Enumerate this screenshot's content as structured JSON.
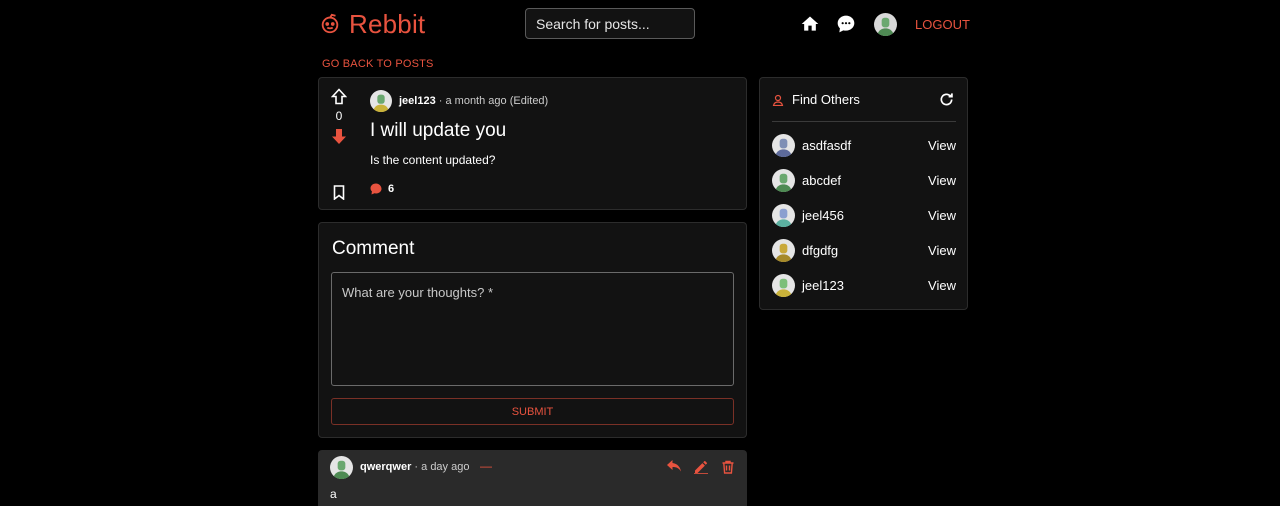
{
  "header": {
    "brand": "Rebbit",
    "search_placeholder": "Search for posts...",
    "logout_label": "LOGOUT",
    "icons": [
      "reddit-logo-icon",
      "home-icon",
      "chat-icon",
      "avatar"
    ]
  },
  "back_link": "GO BACK TO POSTS",
  "post": {
    "author": "jeel123",
    "meta": "· a month ago (Edited)",
    "title": "I will update you",
    "body": "Is the content updated?",
    "votes": "0",
    "comment_count": "6"
  },
  "comment_form": {
    "heading": "Comment",
    "placeholder": "What are your thoughts? *",
    "submit_label": "SUBMIT"
  },
  "reply": {
    "author": "qwerqwer",
    "meta": "· a day ago",
    "collapse": "—",
    "body": "a"
  },
  "find_others": {
    "title": "Find Others",
    "users": [
      {
        "name": "asdfasdf",
        "action": "View",
        "avatar_color": "#7f8fb5"
      },
      {
        "name": "abcdef",
        "action": "View",
        "avatar_color": "#6aa86f"
      },
      {
        "name": "jeel456",
        "action": "View",
        "avatar_color": "#8b9fd0"
      },
      {
        "name": "dfgdfg",
        "action": "View",
        "avatar_color": "#c9a93a"
      },
      {
        "name": "jeel123",
        "action": "View",
        "avatar_color": "#7cbf7a"
      }
    ]
  },
  "colors": {
    "accent": "#e8533f",
    "background": "#000000",
    "card": "#121212",
    "reply_card": "#2a2a2a"
  }
}
